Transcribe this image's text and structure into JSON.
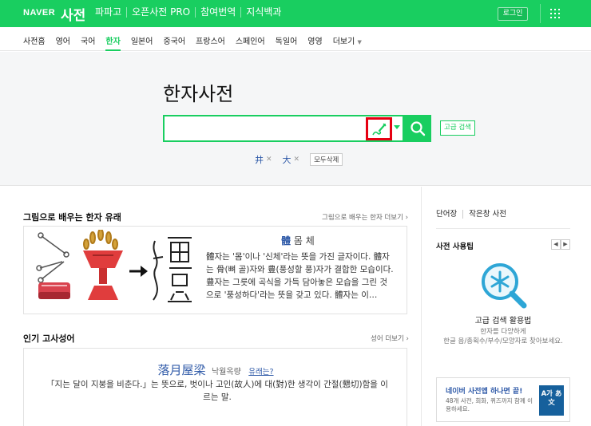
{
  "header": {
    "logo": "NAVER",
    "dict_title": "사전",
    "nav": [
      "파파고",
      "오픈사전 PRO",
      "참여번역",
      "지식백과"
    ],
    "login_label": "로그인",
    "menu_icon": "grid-icon"
  },
  "subnav": {
    "items": [
      "사전홈",
      "영어",
      "국어",
      "한자",
      "일본어",
      "중국어",
      "프랑스어",
      "스페인어",
      "독일어",
      "영영"
    ],
    "more_label": "더보기",
    "active": "한자"
  },
  "search": {
    "title": "한자사전",
    "input_value": "",
    "handwriting_icon": "brush-icon",
    "advanced_label": "고급 검색",
    "recent_terms": [
      "井",
      "大"
    ],
    "delete_all_label": "모두삭제"
  },
  "origin": {
    "heading": "그림으로 배우는 한자 유래",
    "more_label": "그림으로 배우는 한자 더보기",
    "hanja": "體",
    "reading": "몸 체",
    "description": "體자는 '몸'이나 '신체'라는 뜻을 가진 글자이다. 體자는 骨(뼈 골)자와 豊(풍성할 풍)자가 결합한 모습이다. 豊자는 그릇에 곡식을 가득 담아놓은 모습을 그린 것으로 '풍성하다'라는 뜻을 갖고 있다. 體자는 이…"
  },
  "idiom": {
    "heading": "인기 고사성어",
    "more_label": "성어 더보기",
    "hanja": "落月屋梁",
    "reading": "낙월옥량",
    "link_label": "유래는?",
    "description": "「지는 달이 지붕을 비춘다.」는 뜻으로, 벗이나 고인(故人)에 대(對)한 생각이 간절(懇切)함을 이르는 말."
  },
  "sidebar": {
    "links": [
      "단어장",
      "작은창 사전"
    ],
    "tips_heading": "사전 사용팁",
    "tips_icon": "magnifier-icon",
    "tips_caption": "고급 검색 활용법",
    "tips_sub1": "한자를 다양하게",
    "tips_sub2": "한글 음/총획수/부수/모양자로 찾아보세요.",
    "banner_title": "네이버 사전앱 하나면 끝!",
    "banner_desc": "48개 사전, 회화, 퀴즈까지 함께 이용하세요.",
    "banner_icon_text": "A가 あ文"
  },
  "colors": {
    "brand_green": "#19ce60",
    "link_blue": "#2f5aa8",
    "highlight_red": "#e60012"
  }
}
